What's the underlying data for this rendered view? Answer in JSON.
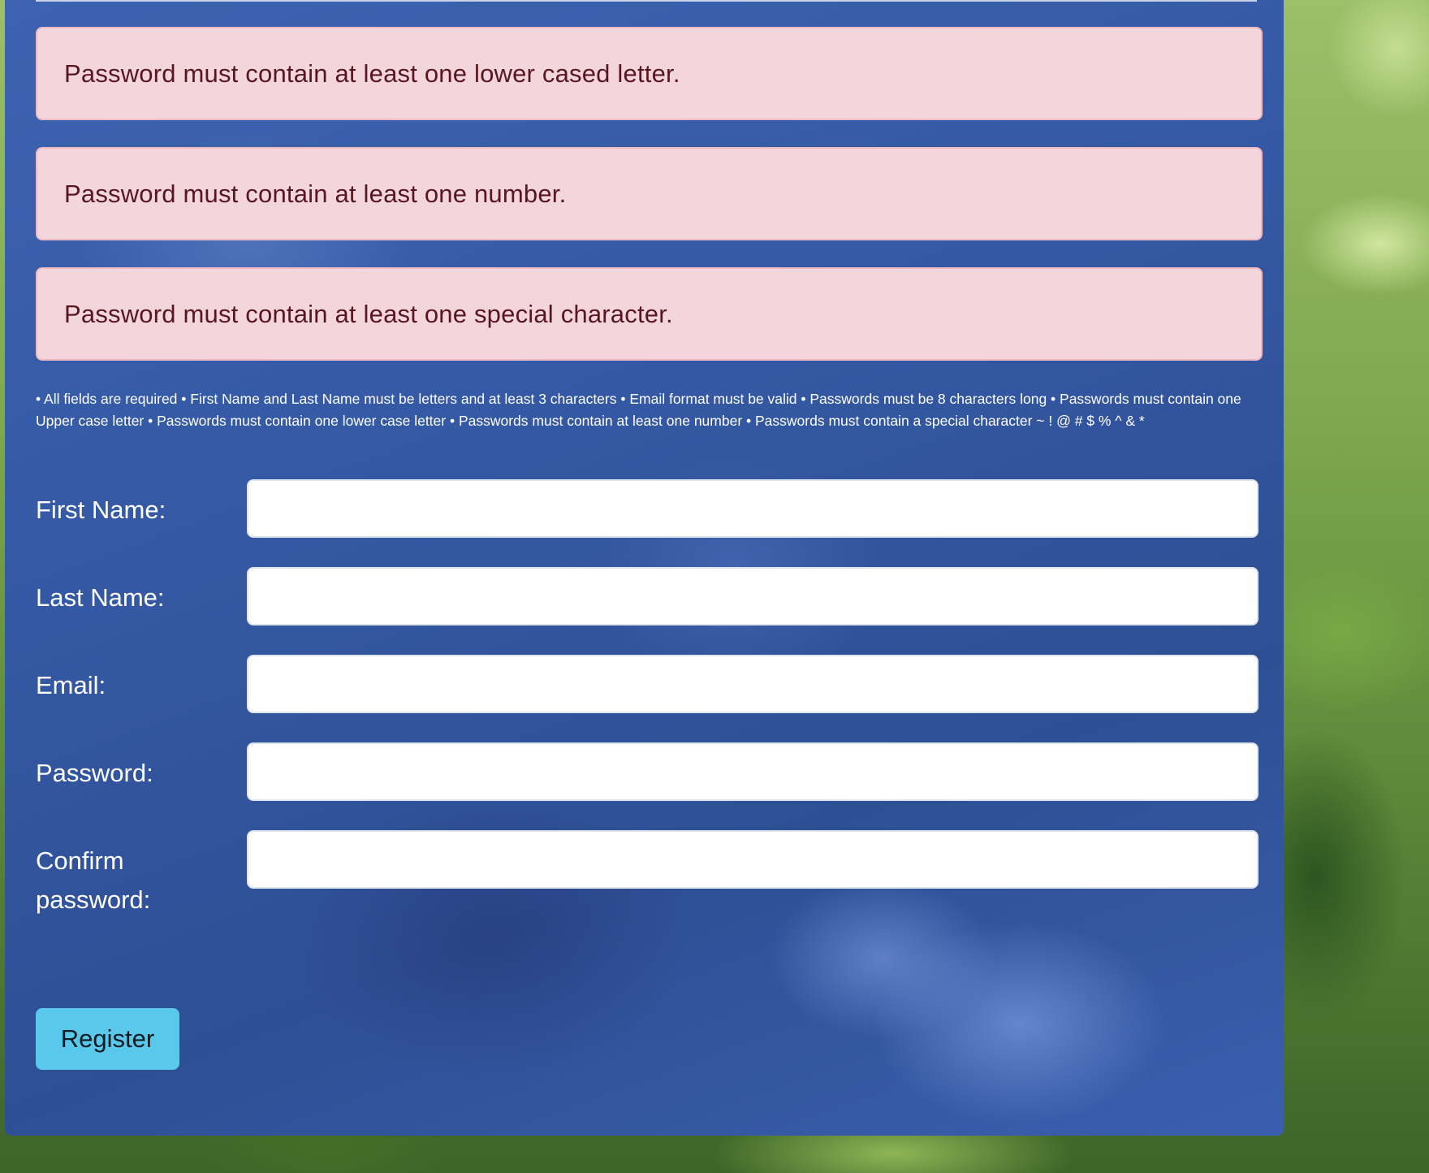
{
  "errors": [
    "Password must contain at least one lower cased letter.",
    "Password must contain at least one number.",
    "Password must contain at least one special character."
  ],
  "rules_text": "• All fields are required • First Name and Last Name must be letters and at least 3 characters • Email format must be valid • Passwords must be 8 characters long • Passwords must contain one Upper case letter • Passwords must contain one lower case letter • Passwords must contain at least one number • Passwords must contain a special character ~ ! @ # $ % ^ & *",
  "form": {
    "first_name": {
      "label": "First Name:",
      "value": ""
    },
    "last_name": {
      "label": "Last Name:",
      "value": ""
    },
    "email": {
      "label": "Email:",
      "value": ""
    },
    "password": {
      "label": "Password:",
      "value": ""
    },
    "confirm_password": {
      "label": "Confirm password:",
      "value": ""
    }
  },
  "register_label": "Register",
  "colors": {
    "alert_bg": "#f3d6dc",
    "alert_text": "#5a1620",
    "panel_bg": "#3458a3",
    "button_bg": "#59c8ea"
  }
}
